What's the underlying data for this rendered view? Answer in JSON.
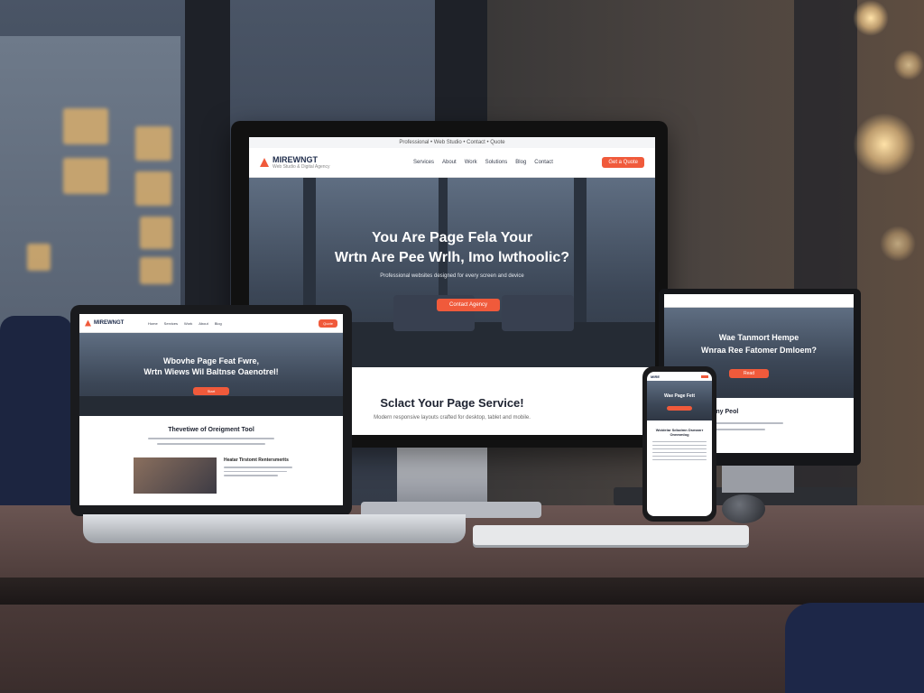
{
  "desktop_site": {
    "logo": "MIREWNGT",
    "tagline": "Web Studio & Digital Agency",
    "announce": "Professional  •  Web Studio  •  Contact  •  Quote",
    "nav": [
      "Services",
      "About",
      "Work",
      "Solutions",
      "Blog",
      "Contact"
    ],
    "cta": "Get a Quote",
    "hero_line1": "You Are Page Fela Your",
    "hero_line2": "Wrtn Are Pee Wrlh, Imo lwthoolic?",
    "hero_sub": "Professional websites designed for every screen and device",
    "hero_button": "Contact Agency",
    "section_title": "Sclact Your Page Service!",
    "section_text": "Modern responsive layouts crafted for desktop, tablet and mobile."
  },
  "laptop_site": {
    "logo": "MIREWNGT",
    "nav": [
      "Home",
      "Services",
      "Work",
      "About",
      "Blog"
    ],
    "cta": "Quote",
    "hero_line1": "Wbovhe Page Feat Fwre,",
    "hero_line2": "Wrtn Wiews Wil Baltnse Oaenotrel!",
    "hero_button": "Start",
    "section_title": "Thevetiwe of Oreigment Tool",
    "card_title": "Heatar Tirstomt Rentersmerits"
  },
  "tablet_site": {
    "hero_line1": "Wae Tanmort Hempe",
    "hero_line2": "Wnraa Ree Fatomer Dmloem?",
    "hero_button": "Read",
    "section_title": "Wen Placafhany Peol"
  },
  "phone_site": {
    "logo": "MIRE",
    "hero_line1": "Wae Page Fett",
    "section_title": "Woidelar Sdiodmn Dsmanrr Onnmmlog"
  },
  "colors": {
    "accent": "#f05a3b",
    "navy": "#1d2b4a",
    "hero": "#3c4757"
  }
}
